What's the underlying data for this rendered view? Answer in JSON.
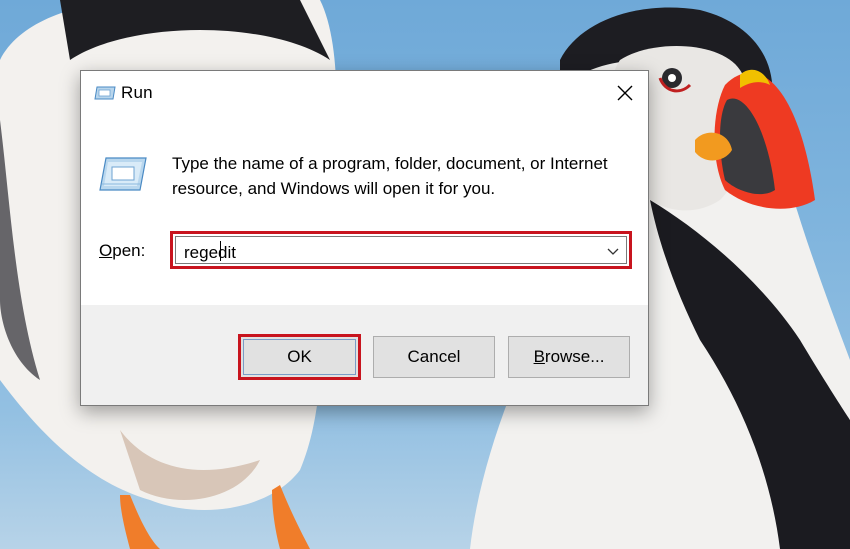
{
  "dialog": {
    "title": "Run",
    "title_icon": "run-icon",
    "close_icon": "close-icon",
    "description": "Type the name of a program, folder, document, or Internet resource, and Windows will open it for you.",
    "open_label_accel": "O",
    "open_label_rest": "pen:",
    "open_value": "regedit",
    "dropdown_icon": "chevron-down-icon"
  },
  "buttons": {
    "ok": "OK",
    "cancel": "Cancel",
    "browse_accel": "B",
    "browse_rest": "rowse..."
  },
  "colors": {
    "highlight": "#c8141e",
    "button_face": "#e1e1e1",
    "footer": "#f0f0f0"
  },
  "wallpaper": "atlantic puffins on blue background"
}
